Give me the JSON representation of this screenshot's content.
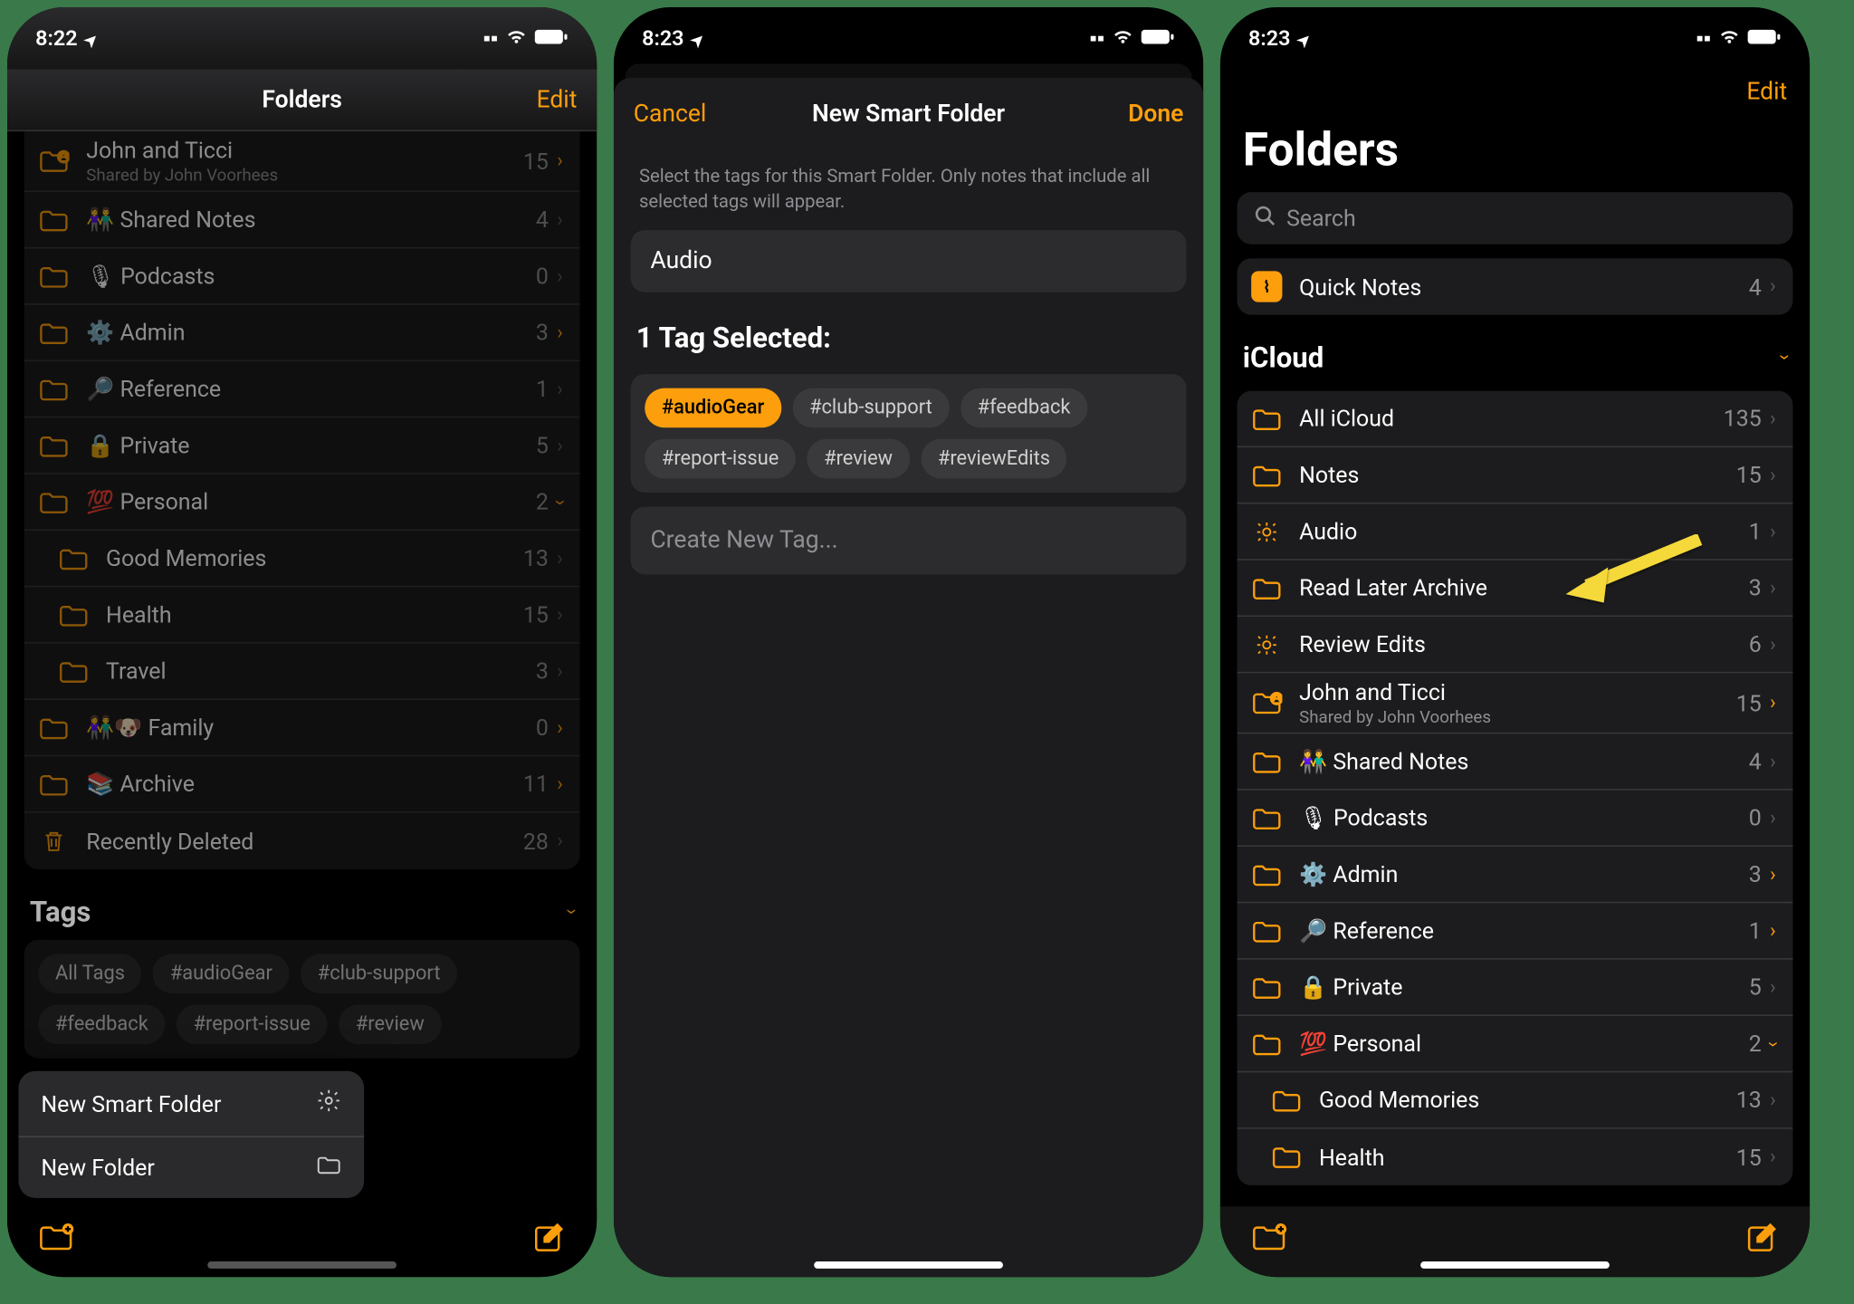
{
  "screen1": {
    "time": "8:22",
    "title": "Folders",
    "edit": "Edit",
    "rows": [
      {
        "label": "John and Ticci",
        "sub": "Shared by John Voorhees",
        "count": "15",
        "gold": true,
        "shared": true
      },
      {
        "label": "👫 Shared Notes",
        "count": "4"
      },
      {
        "label": "🎙 Podcasts",
        "count": "0"
      },
      {
        "label": "⚙️ Admin",
        "count": "3",
        "gold": true
      },
      {
        "label": "🔎 Reference",
        "count": "1"
      },
      {
        "label": "🔒 Private",
        "count": "5"
      },
      {
        "label": "💯 Personal",
        "count": "2",
        "gold": true,
        "expanded": true
      },
      {
        "label": "Good Memories",
        "count": "13",
        "indent": true
      },
      {
        "label": "Health",
        "count": "15",
        "indent": true
      },
      {
        "label": "Travel",
        "count": "3",
        "indent": true
      },
      {
        "label": "👫🐶 Family",
        "count": "0",
        "gold": true
      },
      {
        "label": "📚 Archive",
        "count": "11",
        "gold": true
      },
      {
        "label": "Recently Deleted",
        "count": "28",
        "trash": true
      }
    ],
    "tags_header": "Tags",
    "tags": [
      "All Tags",
      "#audioGear",
      "#club-support",
      "#feedback",
      "#report-issue",
      "#review"
    ],
    "popover": {
      "smart": "New Smart Folder",
      "folder": "New Folder"
    }
  },
  "screen2": {
    "time": "8:23",
    "cancel": "Cancel",
    "title": "New Smart Folder",
    "done": "Done",
    "hint": "Select the tags for this Smart Folder. Only notes that include all selected tags will appear.",
    "name_value": "Audio",
    "selected_header": "1 Tag Selected:",
    "tags": [
      {
        "t": "#audioGear",
        "sel": true
      },
      {
        "t": "#club-support"
      },
      {
        "t": "#feedback"
      },
      {
        "t": "#report-issue"
      },
      {
        "t": "#review"
      },
      {
        "t": "#reviewEdits"
      }
    ],
    "create": "Create New Tag..."
  },
  "screen3": {
    "time": "8:23",
    "edit": "Edit",
    "title": "Folders",
    "search": "Search",
    "quick_notes": {
      "label": "Quick Notes",
      "count": "4"
    },
    "section": "iCloud",
    "rows": [
      {
        "label": "All iCloud",
        "count": "135"
      },
      {
        "label": "Notes",
        "count": "15"
      },
      {
        "label": "Audio",
        "count": "1",
        "smart": true,
        "highlight": true
      },
      {
        "label": "Read Later Archive",
        "count": "3"
      },
      {
        "label": "Review Edits",
        "count": "6",
        "smart": true
      },
      {
        "label": "John and Ticci",
        "sub": "Shared by John Voorhees",
        "count": "15",
        "gold": true,
        "shared": true
      },
      {
        "label": "👫 Shared Notes",
        "count": "4"
      },
      {
        "label": "🎙 Podcasts",
        "count": "0"
      },
      {
        "label": "⚙️ Admin",
        "count": "3",
        "gold": true
      },
      {
        "label": "🔎 Reference",
        "count": "1",
        "gold": true
      },
      {
        "label": "🔒 Private",
        "count": "5"
      },
      {
        "label": "💯 Personal",
        "count": "2",
        "gold": true,
        "expanded": true
      },
      {
        "label": "Good Memories",
        "count": "13",
        "indent": true
      },
      {
        "label": "Health",
        "count": "15",
        "indent": true
      }
    ]
  }
}
